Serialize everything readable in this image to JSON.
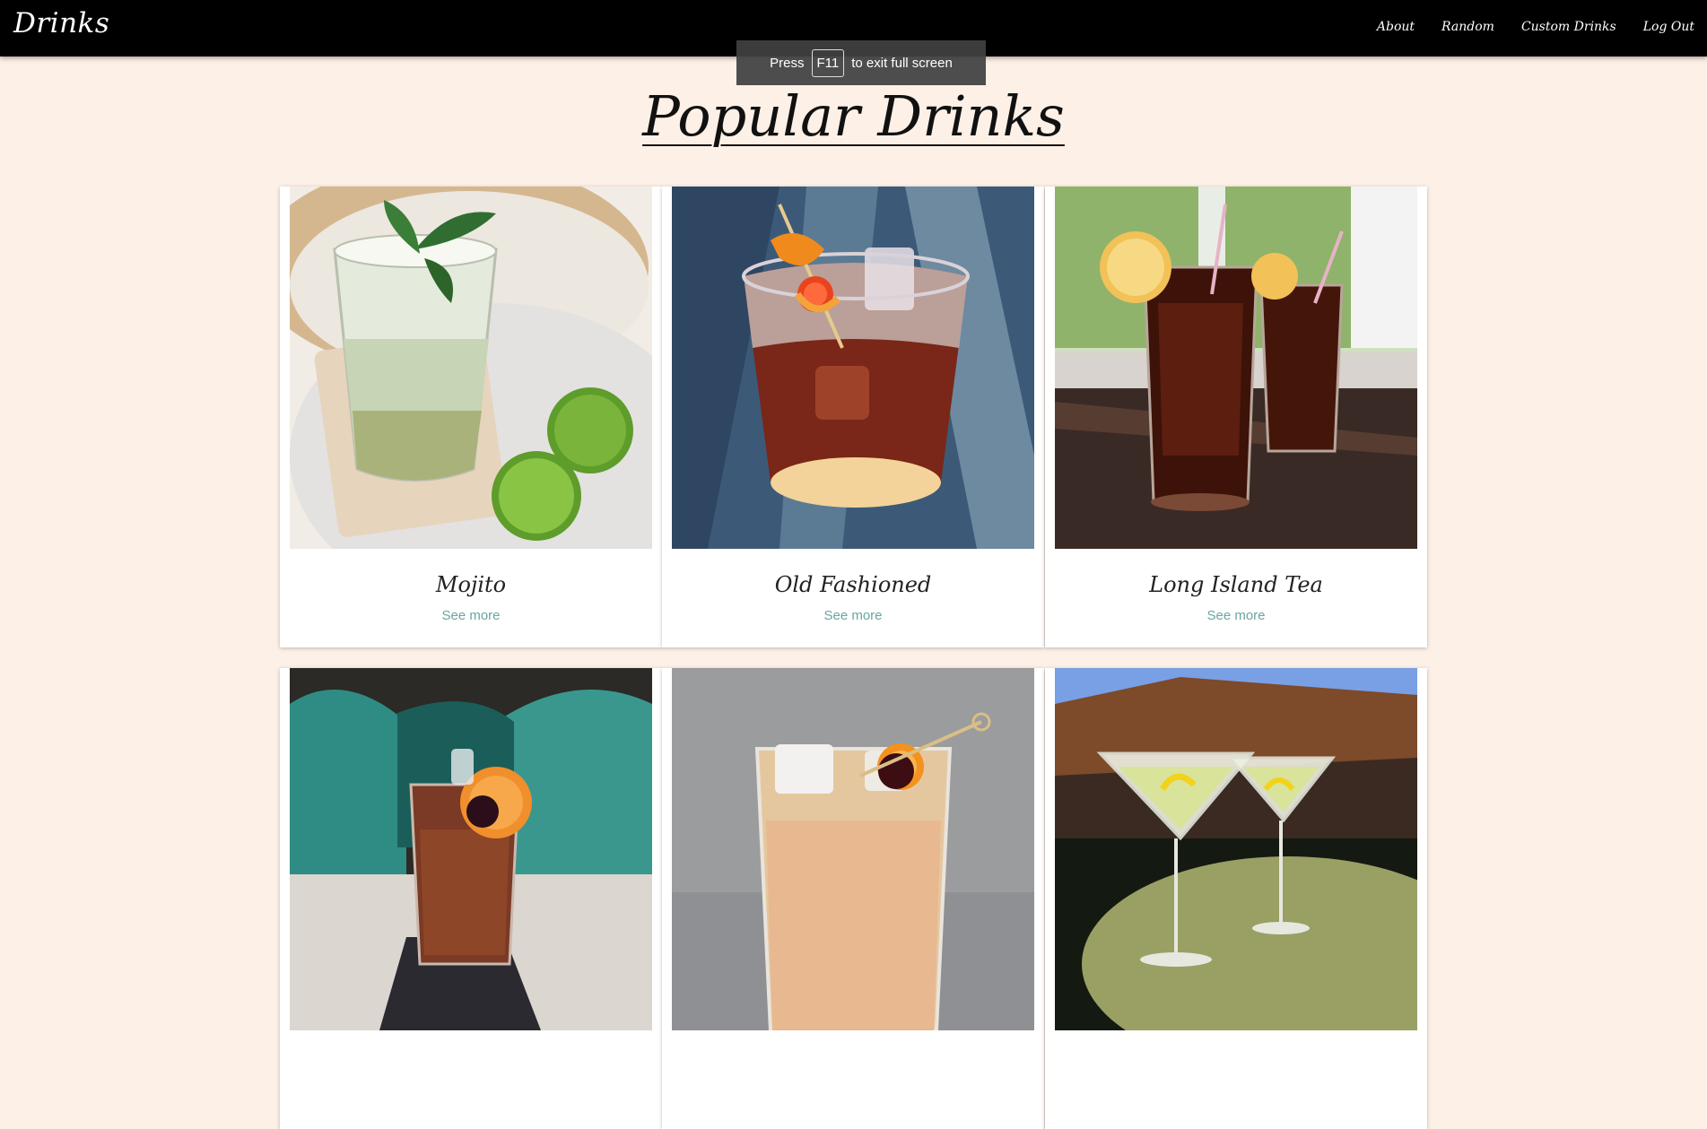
{
  "navbar": {
    "brand": "Drinks",
    "links": [
      "About",
      "Random",
      "Custom Drinks",
      "Log Out"
    ]
  },
  "fullscreen_notice": {
    "before": "Press",
    "key": "F11",
    "after": "to exit full screen"
  },
  "page_title": "Popular Drinks",
  "drinks": [
    {
      "name": "Mojito",
      "link": "See more",
      "photo": "mojito-photo"
    },
    {
      "name": "Old Fashioned",
      "link": "See more",
      "photo": "old-fashioned-photo"
    },
    {
      "name": "Long Island Tea",
      "link": "See more",
      "photo": "long-island-tea-photo"
    },
    {
      "name": "",
      "link": "",
      "photo": "negroni-style-photo"
    },
    {
      "name": "",
      "link": "",
      "photo": "whiskey-sour-photo"
    },
    {
      "name": "",
      "link": "",
      "photo": "martini-photo"
    }
  ],
  "colors": {
    "background": "#fdf0e6",
    "navbar": "#000000",
    "link": "#6aa6a0"
  }
}
